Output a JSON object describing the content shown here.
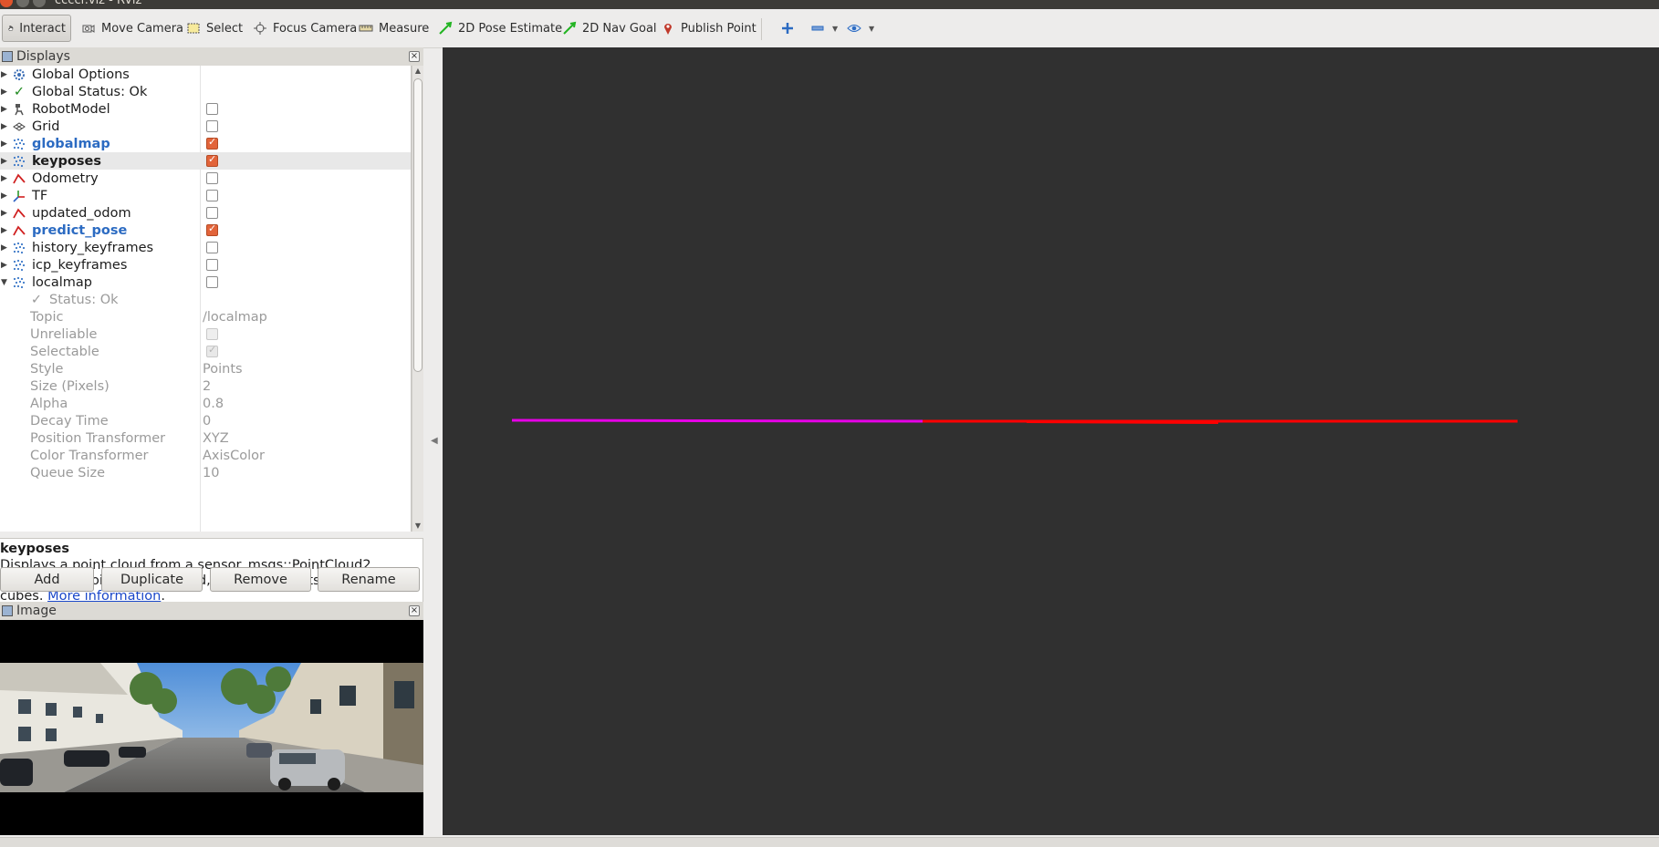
{
  "window": {
    "title": "ccccr.viz - RViz"
  },
  "toolbar": {
    "items": [
      {
        "label": "Interact",
        "icon": "hand-cursor-icon"
      },
      {
        "label": "Move Camera",
        "icon": "move-camera-icon"
      },
      {
        "label": "Select",
        "icon": "select-box-icon"
      },
      {
        "label": "Focus Camera",
        "icon": "focus-crosshair-icon"
      },
      {
        "label": "Measure",
        "icon": "ruler-icon"
      },
      {
        "label": "2D Pose Estimate",
        "icon": "green-arrow-icon"
      },
      {
        "label": "2D Nav Goal",
        "icon": "green-arrow-icon"
      },
      {
        "label": "Publish Point",
        "icon": "map-pin-icon"
      }
    ],
    "active": "Interact"
  },
  "displays": {
    "title": "Displays",
    "tree": [
      {
        "label": "Global Options"
      },
      {
        "label": "Global Status: Ok"
      },
      {
        "label": "RobotModel",
        "checked": false
      },
      {
        "label": "Grid",
        "checked": false
      },
      {
        "label": "globalmap",
        "checked": true
      },
      {
        "label": "keyposes",
        "checked": true
      },
      {
        "label": "Odometry",
        "checked": false
      },
      {
        "label": "TF",
        "checked": false
      },
      {
        "label": "updated_odom",
        "checked": false
      },
      {
        "label": "predict_pose",
        "checked": true
      },
      {
        "label": "history_keyframes",
        "checked": false
      },
      {
        "label": "icp_keyframes",
        "checked": false
      },
      {
        "label": "localmap",
        "checked": false
      }
    ],
    "localmap_props": {
      "status": "Status: Ok",
      "rows": [
        {
          "name": "Topic",
          "value": "/localmap"
        },
        {
          "name": "Unreliable",
          "checked": false
        },
        {
          "name": "Selectable",
          "checked": true
        },
        {
          "name": "Style",
          "value": "Points"
        },
        {
          "name": "Size (Pixels)",
          "value": "2"
        },
        {
          "name": "Alpha",
          "value": "0.8"
        },
        {
          "name": "Decay Time",
          "value": "0"
        },
        {
          "name": "Position Transformer",
          "value": "XYZ"
        },
        {
          "name": "Color Transformer",
          "value": "AxisColor"
        },
        {
          "name": "Queue Size",
          "value": "10"
        }
      ]
    },
    "description": {
      "title": "keyposes",
      "text_before": "Displays a point cloud from a sensor_msgs::PointCloud2 message as points in the world, drawn as points, billboards, or cubes. ",
      "link": "More information",
      "text_after": "."
    },
    "buttons": {
      "add": "Add",
      "duplicate": "Duplicate",
      "remove": "Remove",
      "rename": "Rename"
    }
  },
  "image_panel": {
    "title": "Image"
  },
  "viewport": {
    "background": "#303030",
    "cloud_colors": {
      "left": "#e600e6",
      "right": "#ff0000"
    }
  }
}
